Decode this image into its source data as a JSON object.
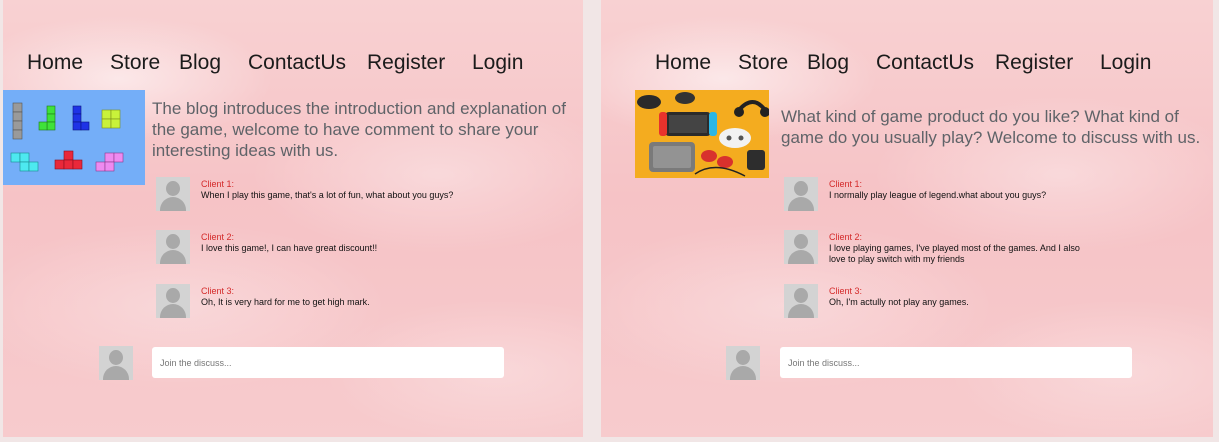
{
  "nav": {
    "home": "Home",
    "store": "Store",
    "blog": "Blog",
    "contact": "ContactUs",
    "register": "Register",
    "login": "Login"
  },
  "left": {
    "intro": "The blog introduces the introduction and explanation of the game, welcome to have comment to share your interesting ideas with us.",
    "comments": [
      {
        "who": "Client 1:",
        "text": "When I play this game, that's a lot of fun, what about you guys?"
      },
      {
        "who": "Client 2:",
        "text": "I love this game!, I can have great discount!!"
      },
      {
        "who": "Client 3:",
        "text": "Oh, It is very hard for me to get high mark."
      }
    ],
    "join_placeholder": "Join the discuss..."
  },
  "right": {
    "intro": "What kind of game product do you like? What kind of game do you usually play? Welcome to discuss with us.",
    "comments": [
      {
        "who": "Client 1:",
        "text": "I normally play league of legend.what about you guys?"
      },
      {
        "who": "Client 2:",
        "text": "I love playing games, I've played most of the games. And I also love to play switch with my friends"
      },
      {
        "who": "Client 3:",
        "text": "Oh, I'm actully not play any games."
      }
    ],
    "join_placeholder": "Join the discuss..."
  },
  "colors": {
    "background": "#f6c3c6",
    "client_name": "#d42a2a",
    "intro_text": "#5f6368",
    "tetris_bg": "#74aef8",
    "console_bg": "#f4ac1f"
  },
  "icons": [
    "user-avatar-icon",
    "tetris-shapes-image",
    "game-controllers-image"
  ]
}
